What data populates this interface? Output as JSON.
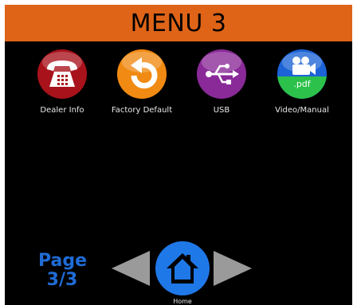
{
  "header": {
    "title": "MENU 3"
  },
  "apps": [
    {
      "label": "Dealer Info",
      "icon": "telephone-icon",
      "color": "#a8121b"
    },
    {
      "label": "Factory Default",
      "icon": "undo-arrow-icon",
      "color": "#f08a12"
    },
    {
      "label": "USB",
      "icon": "usb-icon",
      "color": "#8a2a98"
    },
    {
      "label": "Video/Manual",
      "icon": "video-camera-icon",
      "color": "#1c63d6",
      "badge": ".pdf",
      "badge_color": "#2cc14a"
    }
  ],
  "navigation": {
    "page_word": "Page",
    "page_number": "3/3",
    "home_label": "Home",
    "prev_icon": "left-arrow-icon",
    "next_icon": "right-arrow-icon",
    "home_icon": "house-icon",
    "arrow_color": "#9a9a9a",
    "home_color": "#1f78e8"
  }
}
